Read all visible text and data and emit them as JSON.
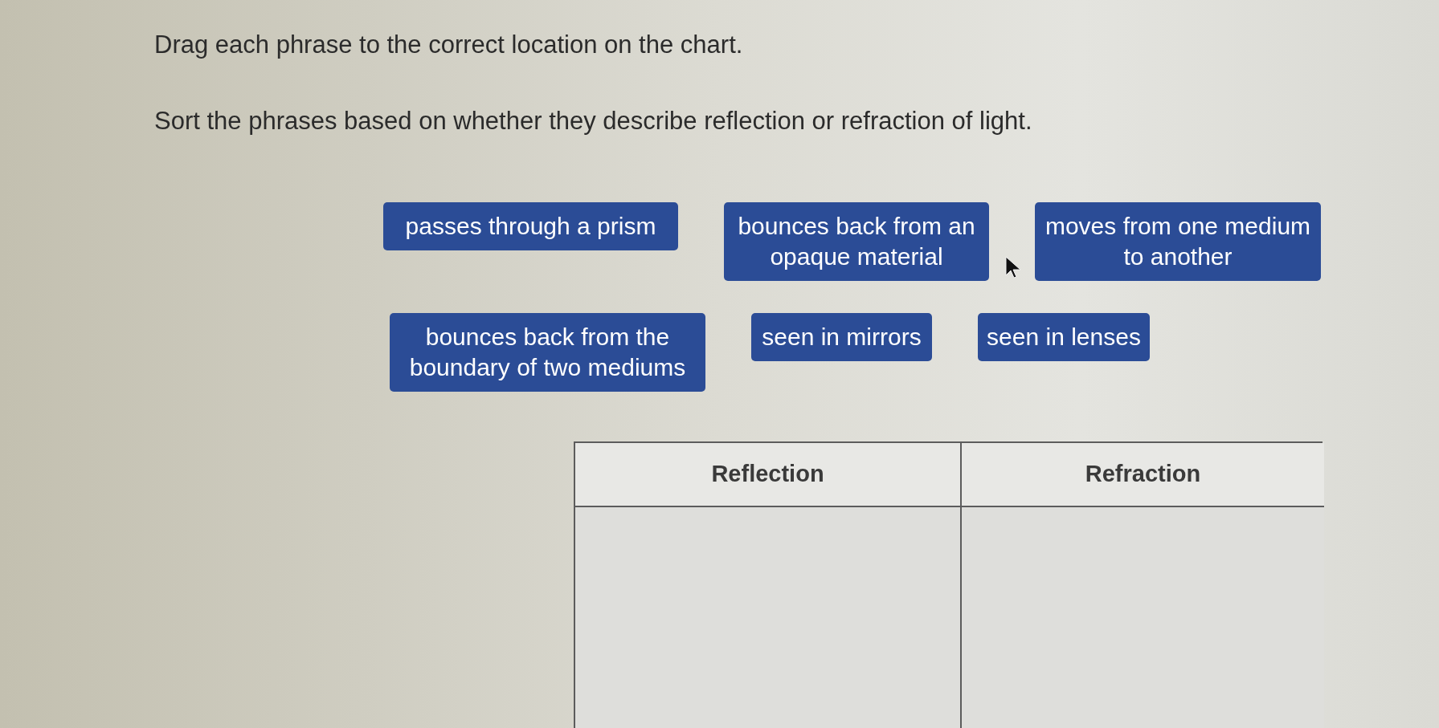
{
  "instructions": [
    "Drag each phrase to the correct location on the chart.",
    "Sort the phrases based on whether they describe reflection or refraction of light."
  ],
  "phrases": [
    "passes through a prism",
    "bounces back from an opaque material",
    "moves from one medium to another",
    "bounces back from the boundary of two mediums",
    "seen in mirrors",
    "seen in lenses"
  ],
  "chart": {
    "columns": [
      "Reflection",
      "Refraction"
    ]
  }
}
